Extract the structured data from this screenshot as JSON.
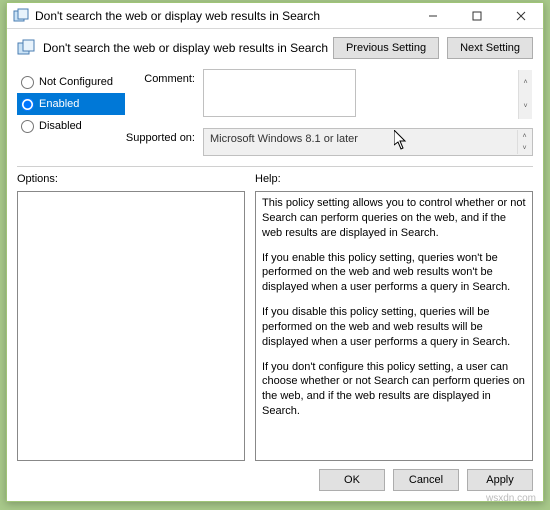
{
  "window": {
    "title": "Don't search the web or display web results in Search"
  },
  "header": {
    "policy_title": "Don't search the web or display web results in Search",
    "prev_btn": "Previous Setting",
    "next_btn": "Next Setting"
  },
  "config": {
    "not_configured": "Not Configured",
    "enabled": "Enabled",
    "disabled": "Disabled",
    "selected": "enabled",
    "comment_label": "Comment:",
    "comment_value": "",
    "supported_label": "Supported on:",
    "supported_value": "Microsoft Windows 8.1 or later"
  },
  "labels": {
    "options": "Options:",
    "help": "Help:"
  },
  "help": {
    "p1": "This policy setting allows you to control whether or not Search can perform queries on the web, and if the web results are displayed in Search.",
    "p2": "If you enable this policy setting, queries won't be performed on the web and web results won't be displayed when a user performs a query in Search.",
    "p3": "If you disable this policy setting, queries will be performed on the web and web results will be displayed when a user performs a query in Search.",
    "p4": "If you don't configure this policy setting, a user can choose whether or not Search can perform queries on the web, and if the web results are displayed in Search."
  },
  "footer": {
    "ok": "OK",
    "cancel": "Cancel",
    "apply": "Apply"
  },
  "watermark": "wsxdn.com"
}
